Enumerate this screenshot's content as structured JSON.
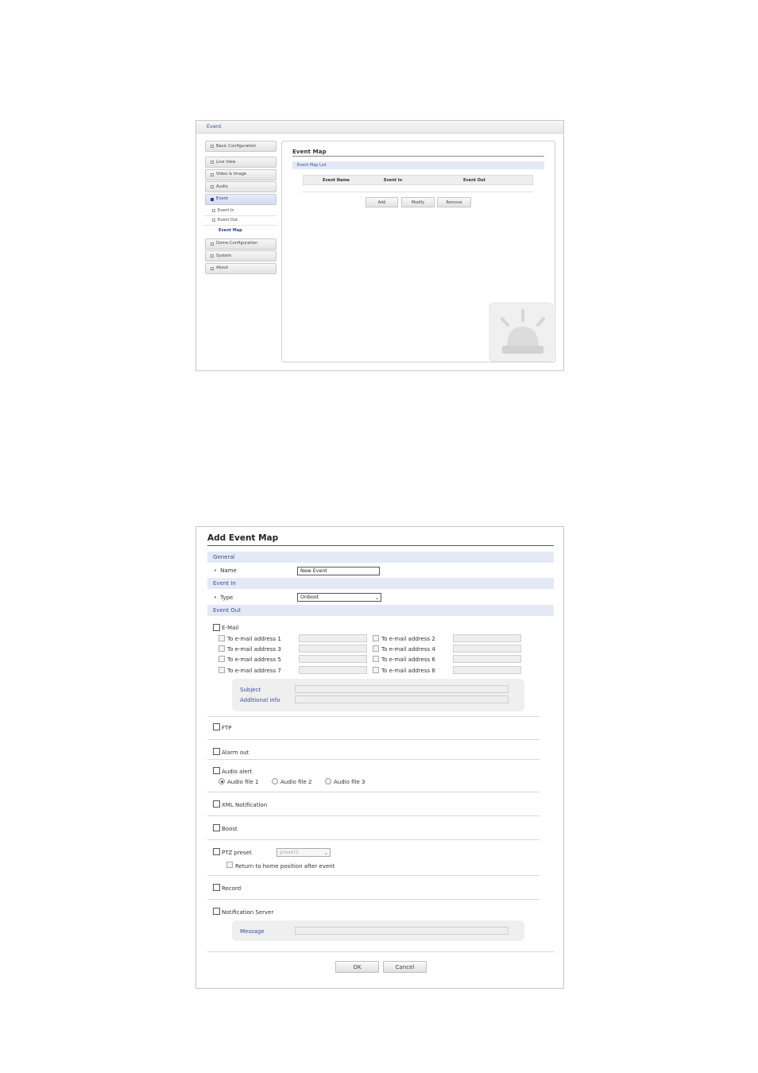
{
  "event_panel": {
    "window_title": "Event",
    "sidebar": {
      "items": [
        {
          "label": "Basic Configuration"
        },
        {
          "label": "Live View"
        },
        {
          "label": "Video & Image"
        },
        {
          "label": "Audio"
        },
        {
          "label": "Event",
          "active": true
        },
        {
          "label": "Dome Configuration"
        },
        {
          "label": "System"
        },
        {
          "label": "About"
        }
      ],
      "event_subitems": [
        "Event In",
        "Event Out",
        "Event Map"
      ]
    },
    "content": {
      "title": "Event Map",
      "list_header": "Event Map List",
      "columns": [
        "Event Name",
        "Event In",
        "Event Out"
      ],
      "buttons": {
        "add": "Add",
        "modify": "Modify",
        "remove": "Remove"
      }
    }
  },
  "add_event_map": {
    "title": "Add Event Map",
    "sections": {
      "general": "General",
      "event_in": "Event In",
      "event_out": "Event Out"
    },
    "general": {
      "name_label": "Name",
      "name_value": "New Event"
    },
    "event_in": {
      "type_label": "Type",
      "type_value": "Onboot"
    },
    "event_out": {
      "email": {
        "label": "E-Mail",
        "addresses": [
          "To e-mail address 1",
          "To e-mail address 2",
          "To e-mail address 3",
          "To e-mail address 4",
          "To e-mail address 5",
          "To e-mail address 6",
          "To e-mail address 7",
          "To e-mail address 8"
        ],
        "subject_label": "Subject",
        "additional_label": "Additional info"
      },
      "ftp": "FTP",
      "alarm_out": "Alarm out",
      "audio_alert": {
        "label": "Audio alert",
        "files": [
          "Audio file 1",
          "Audio file 2",
          "Audio file 3"
        ],
        "selected": "Audio file 1"
      },
      "xml_notification": "XML Notification",
      "boost": "Boost",
      "ptz_preset": {
        "label": "PTZ preset",
        "value": "preset1",
        "return_home": "Return to home position after event"
      },
      "record": "Record",
      "notification_server": {
        "label": "Notification Server",
        "message_label": "Message"
      }
    },
    "buttons": {
      "ok": "OK",
      "cancel": "Cancel"
    }
  }
}
